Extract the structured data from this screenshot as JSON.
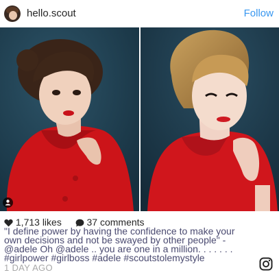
{
  "header": {
    "username": "hello.scout",
    "follow_label": "Follow"
  },
  "post": {
    "likes_text": "1,713 likes",
    "comments_text": "37 comments",
    "caption_lines": [
      "\"I define power by having the confidence to make your",
      "own decisions and not be swayed by other people\" -",
      "@adele Oh @adele .. you are one in a million. . . . . . .",
      "#girlpower #girlboss #adele #scoutstolemystyle"
    ],
    "timestamp": "1 DAY AGO"
  },
  "icons": {
    "likes": "heart-icon",
    "comments": "speech-bubble-icon",
    "tag": "person-tag-icon",
    "brand": "instagram-glyph-icon"
  },
  "colors": {
    "follow": "#3897f0",
    "backdrop": "#1f3d4f",
    "coat_red": "#d0161c",
    "timestamp": "#a8a8a8"
  }
}
